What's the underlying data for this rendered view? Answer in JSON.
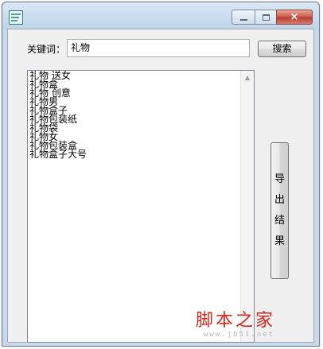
{
  "window": {
    "title": "",
    "controls": {
      "minimize": "minimize",
      "maximize": "maximize",
      "close": "×"
    }
  },
  "search": {
    "label": "关键词：",
    "value": "礼物",
    "button": "搜索"
  },
  "results": [
    "礼物 送女",
    "礼物盒",
    "礼物 创意",
    "礼物男",
    "礼物盒子",
    "礼物包装纸",
    "礼物袋",
    "礼物女",
    "礼物包装盒",
    "礼物盒子大号"
  ],
  "export_button": [
    "导",
    "出",
    "结",
    "果"
  ],
  "watermark": {
    "brand": "脚本之家",
    "url": "www.jb51.net"
  },
  "colors": {
    "titlebar": "#c9d9ea",
    "close_button": "#c8574a",
    "watermark_red": "#d8261c"
  }
}
